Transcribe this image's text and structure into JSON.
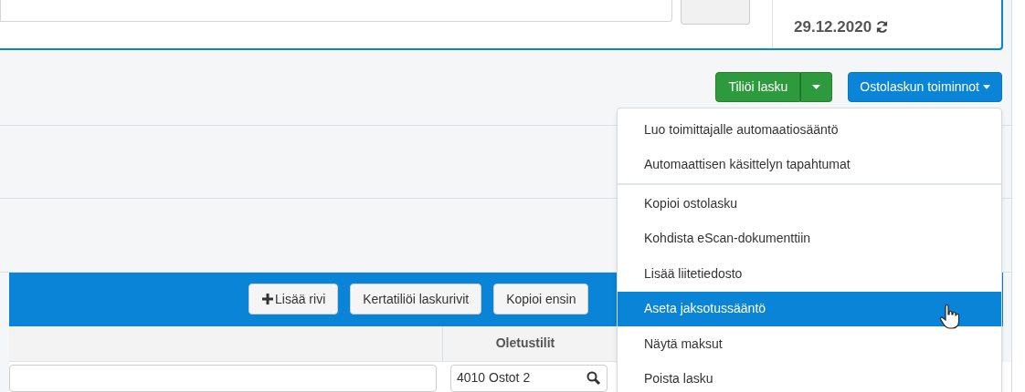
{
  "header": {
    "date": "29.12.2020"
  },
  "actions": {
    "post_button": "Tiliöi lasku",
    "menu_button": "Ostolaskun toiminnot"
  },
  "menu": {
    "groups": [
      [
        {
          "label": "Luo toimittajalle automaatiosääntö",
          "selected": false
        },
        {
          "label": "Automaattisen käsittelyn tapahtumat",
          "selected": false
        }
      ],
      [
        {
          "label": "Kopioi ostolasku",
          "selected": false
        },
        {
          "label": "Kohdista eScan-dokumenttiin",
          "selected": false
        },
        {
          "label": "Lisää liitetiedosto",
          "selected": false
        },
        {
          "label": "Aseta jaksotussääntö",
          "selected": true
        },
        {
          "label": "Näytä maksut",
          "selected": false
        },
        {
          "label": "Poista lasku",
          "selected": false
        }
      ]
    ]
  },
  "toolbar": {
    "buttons": [
      {
        "kind": "add",
        "label": "Lisää rivi"
      },
      {
        "kind": "plain",
        "label": "Kertatiliöi laskurivit"
      },
      {
        "kind": "plain",
        "label": "Kopioi ensin"
      }
    ]
  },
  "table": {
    "columns": [
      "Oletustilit"
    ],
    "default_account": "4010 Ostot 2"
  }
}
